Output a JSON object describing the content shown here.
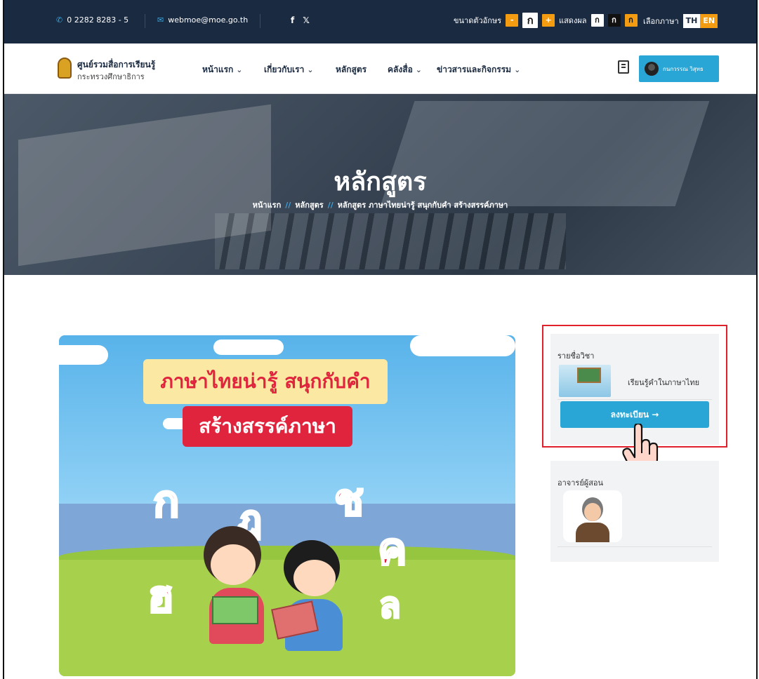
{
  "topbar": {
    "phone": "0 2282 8283 - 5",
    "email": "webmoe@moe.go.th",
    "social": [
      "f",
      "𝕏"
    ],
    "font_size_label": "ขนาดตัวอักษร",
    "font_minus": "-",
    "font_current": "ก",
    "font_plus": "+",
    "display_label": "แสดงผล",
    "display_options": [
      "ก",
      "ก",
      "ก"
    ],
    "language_label": "เลือกภาษา",
    "languages": [
      "TH",
      "EN"
    ]
  },
  "nav": {
    "logo_title": "ศูนย์รวมสื่อการเรียนรู้",
    "logo_subtitle": "กระทรวงศึกษาธิการ",
    "menu": [
      {
        "label": "หน้าแรก",
        "caret": "⌄"
      },
      {
        "label": "เกี่ยวกับเรา",
        "caret": "⌄"
      },
      {
        "label": "หลักสูตร",
        "caret": ""
      },
      {
        "label": "คลังสื่อ",
        "caret": "⌄"
      },
      {
        "label": "ข่าวสารและกิจกรรม",
        "caret": "⌄"
      }
    ],
    "profile_name": "กนกวรรณ วิสุทธ"
  },
  "hero": {
    "title": "หลักสูตร",
    "breadcrumb": [
      "หน้าแรก",
      "หลักสูตร",
      "หลักสูตร ภาษาไทยน่ารู้ สนุกกับคำ สร้างสรรค์ภาษา"
    ],
    "separator": "//"
  },
  "course": {
    "banner_line1": "ภาษาไทยน่ารู้ สนุกกับคำ",
    "banner_line2": "สร้างสรรค์ภาษา",
    "letters": [
      "ก",
      "ฎ",
      "ช",
      "ค",
      "ฮ",
      "ล"
    ]
  },
  "sidebar": {
    "subject_heading": "รายชื่อวิชา",
    "subject_name": "เรียนรู้คำในภาษาไทย",
    "enroll_label": "ลงทะเบียน →",
    "teacher_heading": "อาจารย์ผู้สอน"
  },
  "colors": {
    "topbar": "#1a2a40",
    "accent": "#2aa6d6",
    "orange": "#f39c12",
    "highlight": "#e0202a"
  }
}
